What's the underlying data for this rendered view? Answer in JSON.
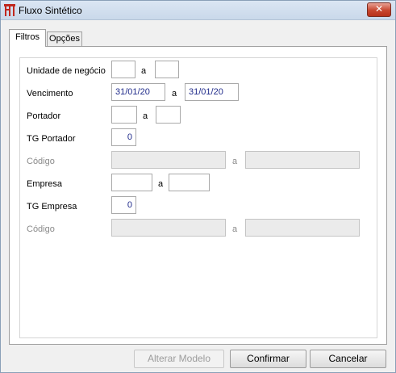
{
  "window": {
    "title": "Fluxo Sintético",
    "close_glyph": "✕"
  },
  "tabs": [
    {
      "label": "Filtros",
      "active": true
    },
    {
      "label": "Opções",
      "active": false
    }
  ],
  "filters": {
    "unidade": {
      "label": "Unidade de negócio",
      "sep": "a",
      "from": "",
      "to": ""
    },
    "vencimento": {
      "label": "Vencimento",
      "sep": "a",
      "from": "31/01/20",
      "to": "31/01/20"
    },
    "portador": {
      "label": "Portador",
      "sep": "a",
      "from": "",
      "to": ""
    },
    "tg_portador": {
      "label": "TG Portador",
      "value": "0"
    },
    "codigo1": {
      "label": "Código",
      "sep": "a",
      "from": "",
      "to": "",
      "enabled": false
    },
    "empresa": {
      "label": "Empresa",
      "sep": "a",
      "from": "",
      "to": ""
    },
    "tg_empresa": {
      "label": "TG Empresa",
      "value": "0"
    },
    "codigo2": {
      "label": "Código",
      "sep": "a",
      "from": "",
      "to": "",
      "enabled": false
    }
  },
  "buttons": {
    "alterar": {
      "label": "Alterar Modelo",
      "enabled": false
    },
    "confirmar": {
      "label": "Confirmar",
      "enabled": true
    },
    "cancelar": {
      "label": "Cancelar",
      "enabled": true
    }
  },
  "colors": {
    "app_icon": "#c0281e",
    "field_text": "#1f2a8a"
  }
}
